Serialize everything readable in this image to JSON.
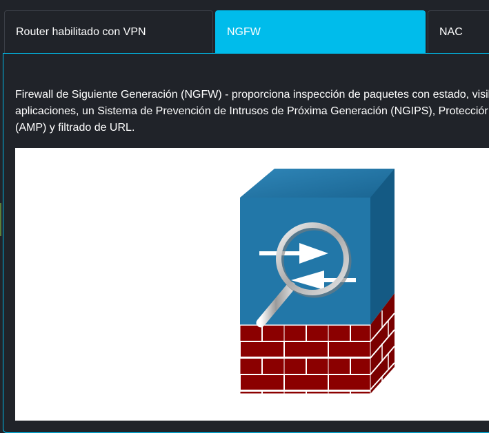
{
  "tabs": [
    {
      "label": "Router habilitado con VPN",
      "active": false
    },
    {
      "label": "NGFW",
      "active": true
    },
    {
      "label": "NAC",
      "active": false
    }
  ],
  "content": {
    "description_lines": [
      "Firewall de Siguiente Generación (NGFW) - proporciona inspección de paquetes con estado, visil",
      "aplicaciones, un Sistema de Prevención de Intrusos de Próxima Generación (NGIPS), Protecciór",
      "(AMP) y filtrado de URL."
    ],
    "image": {
      "icon": "ngfw-firewall-icon"
    }
  },
  "colors": {
    "accent": "#00bceb",
    "background": "#202329",
    "device_blue": "#2277a8",
    "brick_red": "#8b0000"
  }
}
